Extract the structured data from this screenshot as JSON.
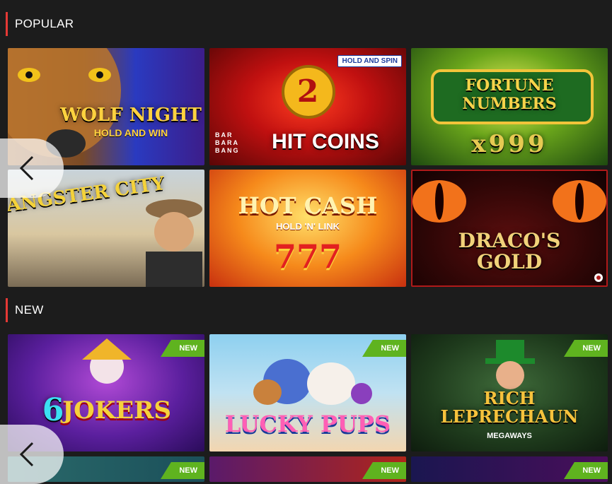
{
  "sections": [
    {
      "title": "POPULAR",
      "games": [
        {
          "title": "WOLF NIGHT",
          "subtitle": "HOLD AND WIN"
        },
        {
          "title": "HIT COINS",
          "subtitle": "",
          "feature_badge": "HOLD AND SPIN",
          "provider_logo": "BAR BARA BANG",
          "big_digit": "2"
        },
        {
          "title": "FORTUNE NUMBERS",
          "subtitle": "x999"
        },
        {
          "title": "GANGSTER CITY",
          "subtitle": ""
        },
        {
          "title": "HOT CASH",
          "subtitle": "HOLD 'N' LINK",
          "big_digit": "777"
        },
        {
          "title": "DRACO'S GOLD",
          "subtitle": ""
        }
      ]
    },
    {
      "title": "NEW",
      "badge": "NEW",
      "games": [
        {
          "title": "JOKERS",
          "prefix": "6"
        },
        {
          "title": "LUCKY PUPS"
        },
        {
          "title": "RICH LEPRECHAUN",
          "subtitle": "MEGAWAYS"
        },
        {
          "title": ""
        },
        {
          "title": ""
        },
        {
          "title": ""
        }
      ]
    }
  ],
  "icons": {
    "prev_arrow": "chevron-left-icon"
  },
  "colors": {
    "background": "#1c1c1c",
    "accent": "#e53935",
    "new_badge": "#5fb31f"
  }
}
